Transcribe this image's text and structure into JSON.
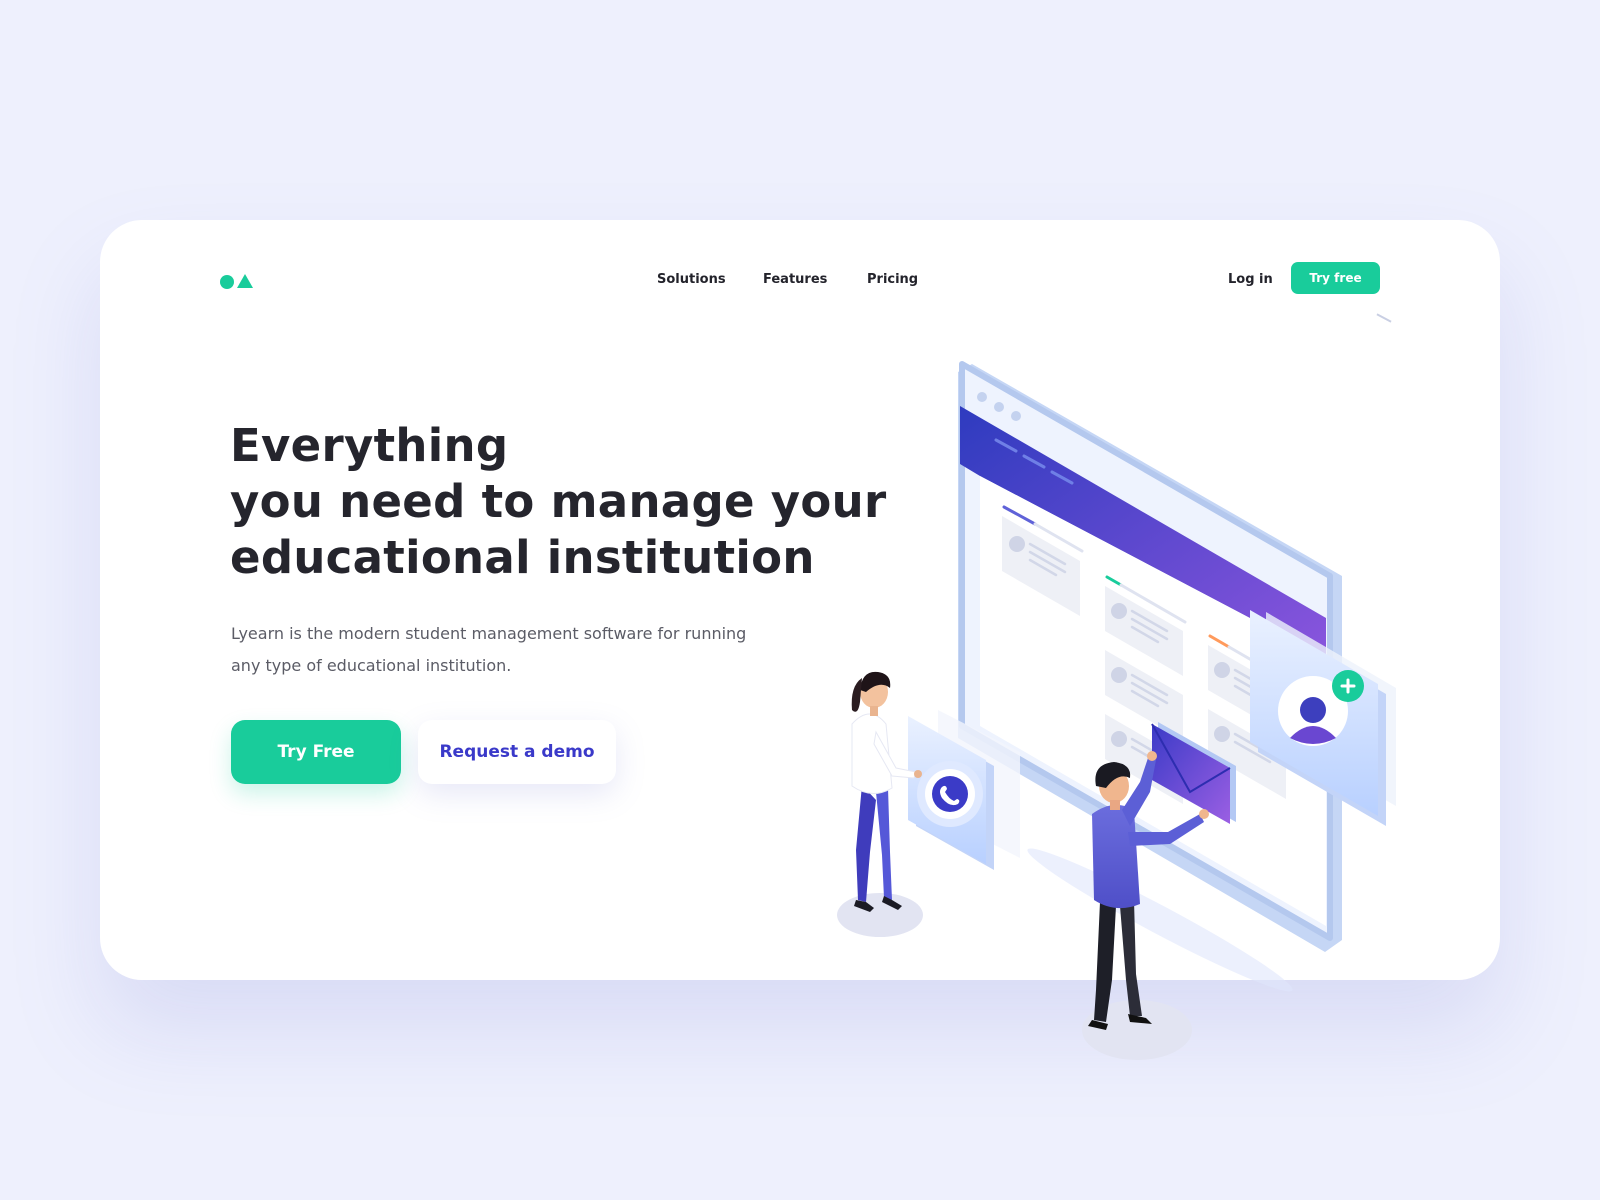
{
  "header": {
    "nav": [
      {
        "label": "Solutions"
      },
      {
        "label": "Features"
      },
      {
        "label": "Pricing"
      }
    ],
    "login_label": "Log in",
    "try_label": "Try free"
  },
  "hero": {
    "title_lines": [
      "Everything",
      "you need to manage your",
      "educational institution"
    ],
    "subtitle": "Lyearn is the modern student management software for running any type of educational institution.",
    "primary_cta": "Try Free",
    "secondary_cta": "Request a demo"
  },
  "colors": {
    "background": "#eef0fd",
    "brand": "#19cc9b",
    "accent": "#3a39c9",
    "text": "#25252d"
  },
  "illustration": {
    "icons": [
      "logo-icon",
      "phone-icon",
      "mail-icon",
      "user-icon",
      "plus-icon"
    ]
  }
}
